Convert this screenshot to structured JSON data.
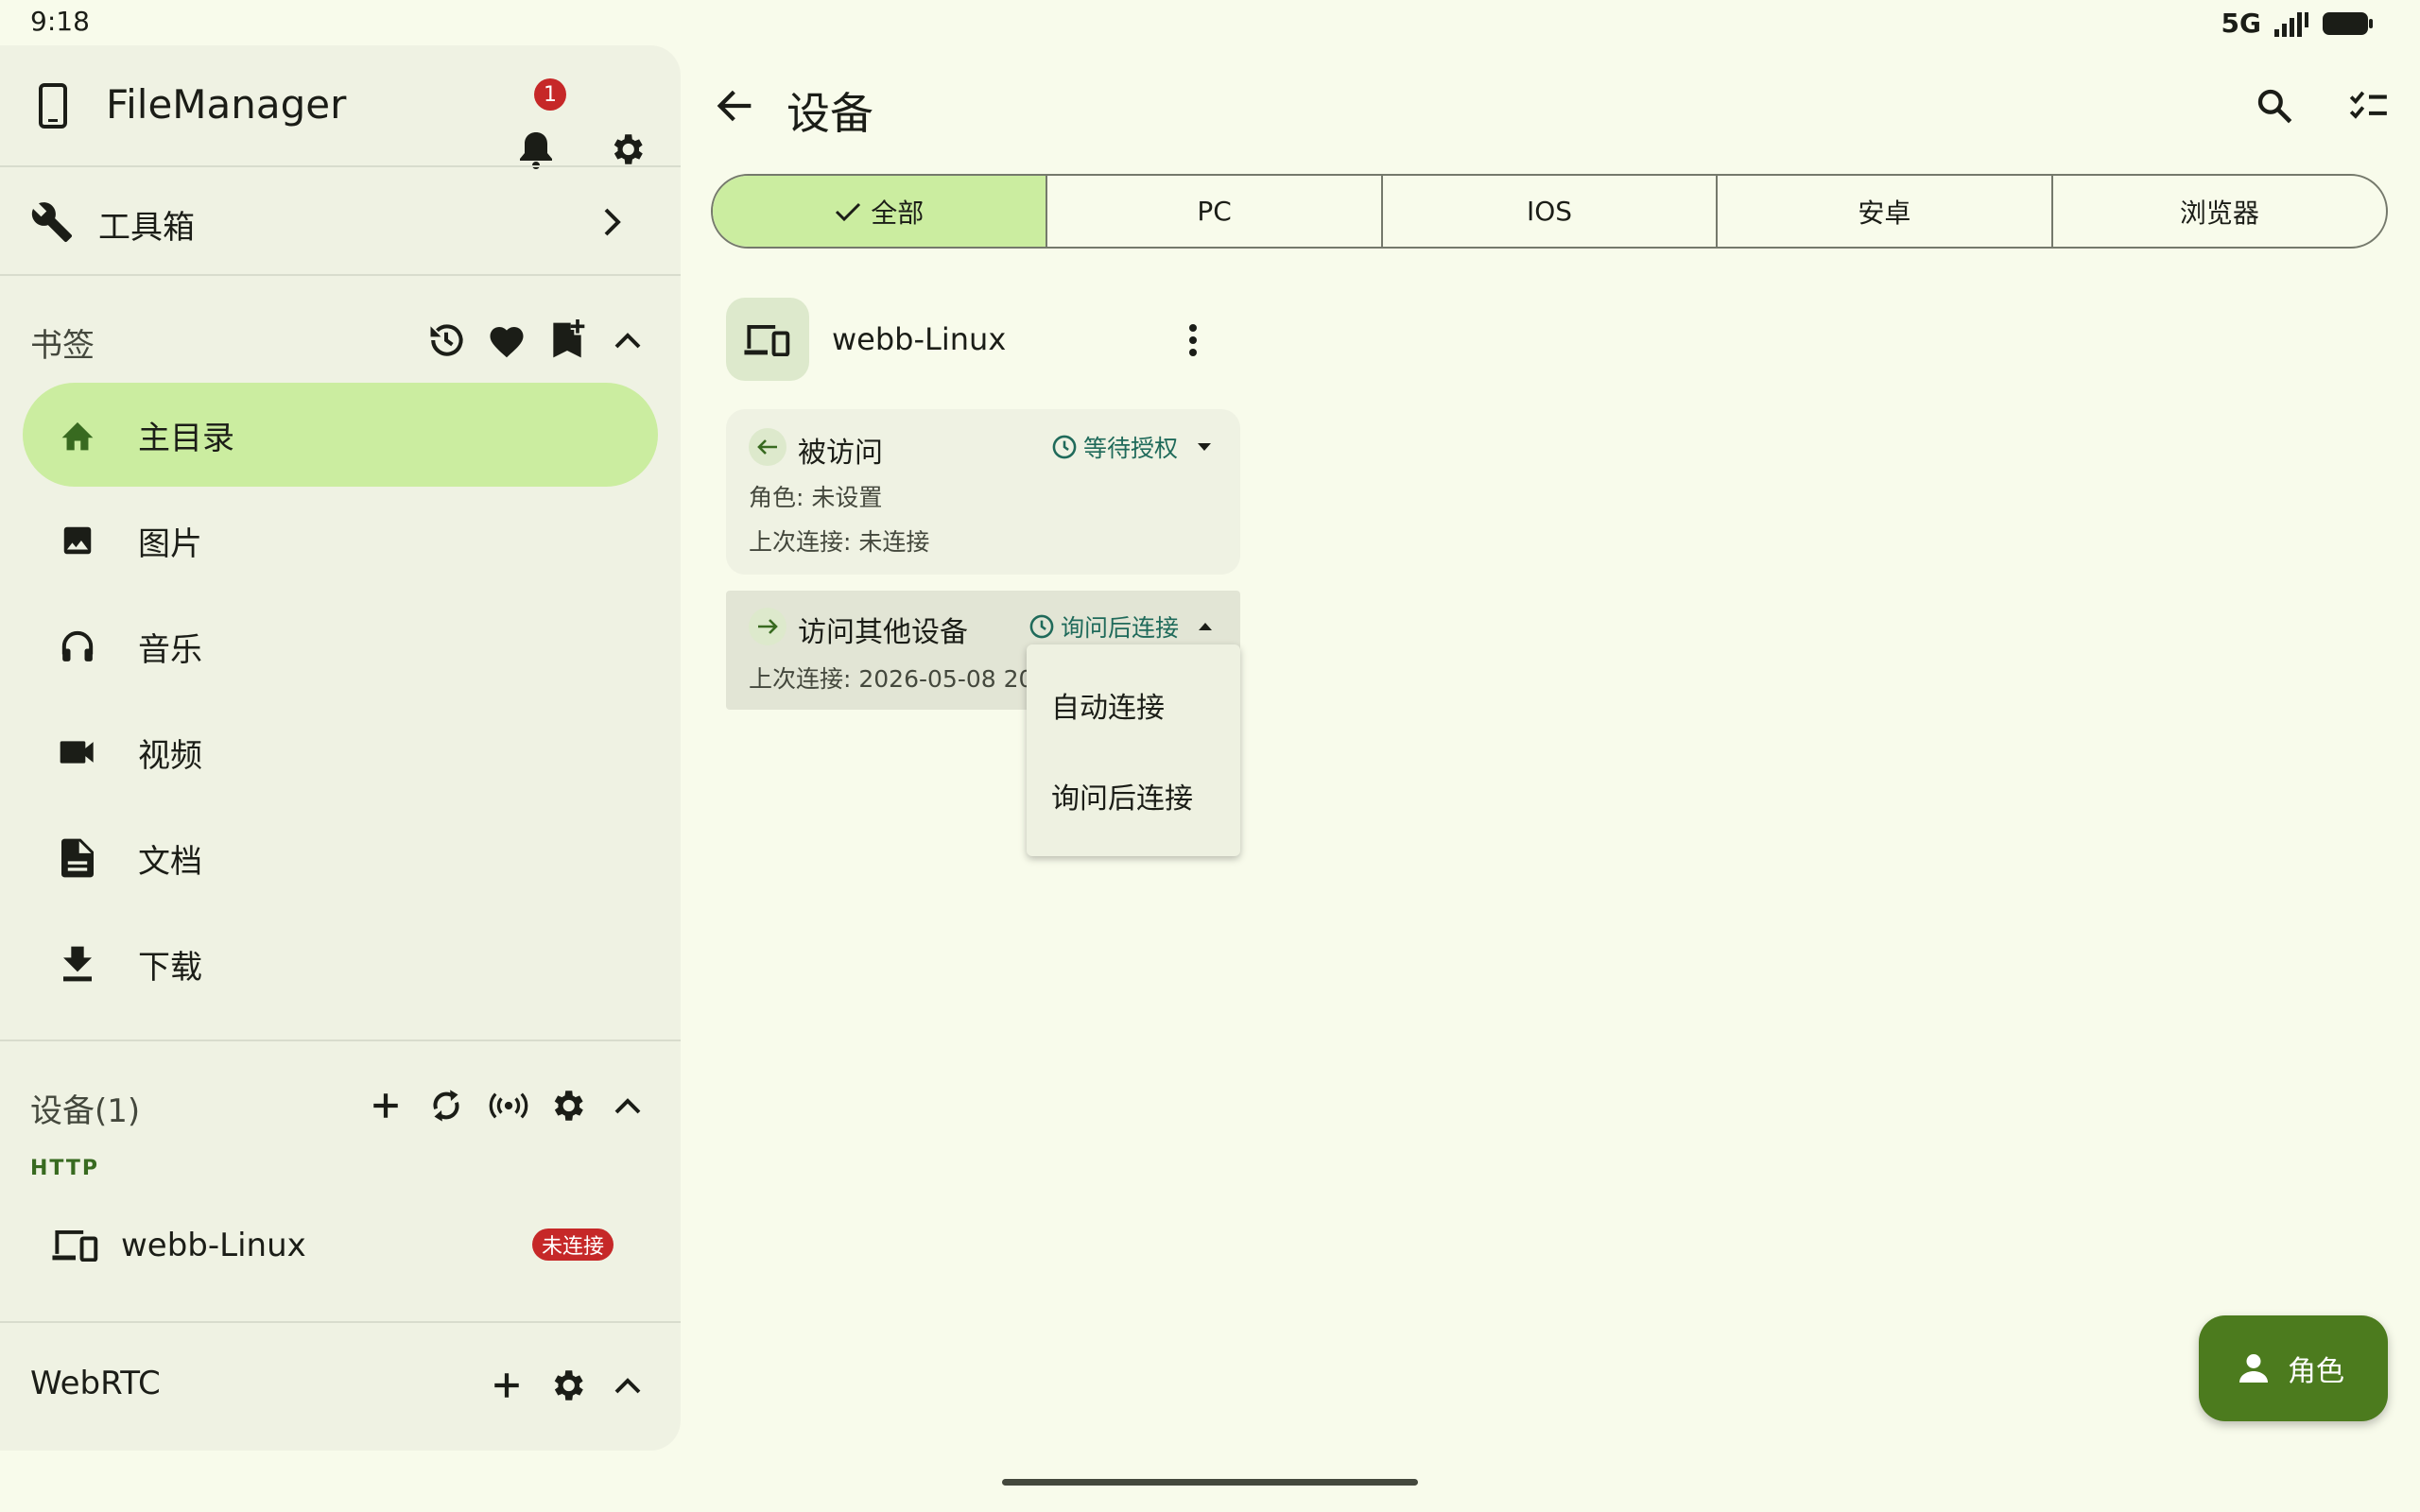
{
  "status_bar": {
    "time": "9:18",
    "network": "5G"
  },
  "drawer": {
    "app_title": "FileManager",
    "notification_count": "1",
    "toolbox_label": "工具箱",
    "bookmarks": {
      "title": "书签",
      "items": [
        {
          "label": "主目录",
          "icon": "home-icon",
          "active": true
        },
        {
          "label": "图片",
          "icon": "image-icon"
        },
        {
          "label": "音乐",
          "icon": "headphones-icon"
        },
        {
          "label": "视频",
          "icon": "videocam-icon"
        },
        {
          "label": "文档",
          "icon": "document-icon"
        },
        {
          "label": "下载",
          "icon": "download-icon"
        }
      ]
    },
    "devices": {
      "title": "设备(1)",
      "protocol": "HTTP",
      "device_name": "webb-Linux",
      "status": "未连接"
    },
    "webrtc": {
      "title": "WebRTC"
    }
  },
  "header": {
    "title": "设备"
  },
  "filters": {
    "segments": [
      {
        "label": "全部",
        "selected": true
      },
      {
        "label": "PC"
      },
      {
        "label": "IOS"
      },
      {
        "label": "安卓"
      },
      {
        "label": "浏览器"
      }
    ]
  },
  "device": {
    "name": "webb-Linux",
    "incoming": {
      "title": "被访问",
      "status": "等待授权",
      "role": "角色: 未设置",
      "last_connection": "上次连接: 未连接"
    },
    "outgoing": {
      "title": "访问其他设备",
      "status": "询问后连接",
      "last_connection": "上次连接: 2026-05-08 20:4"
    }
  },
  "dropdown": {
    "options": [
      "自动连接",
      "询问后连接"
    ]
  },
  "fab": {
    "label": "角色"
  },
  "colors": {
    "background": "#f8fbeb",
    "drawer": "#eff2e3",
    "accent_container": "#cbeda0",
    "primary": "#4c7b1e",
    "error": "#c62828",
    "status_teal": "#1f6a5a"
  }
}
